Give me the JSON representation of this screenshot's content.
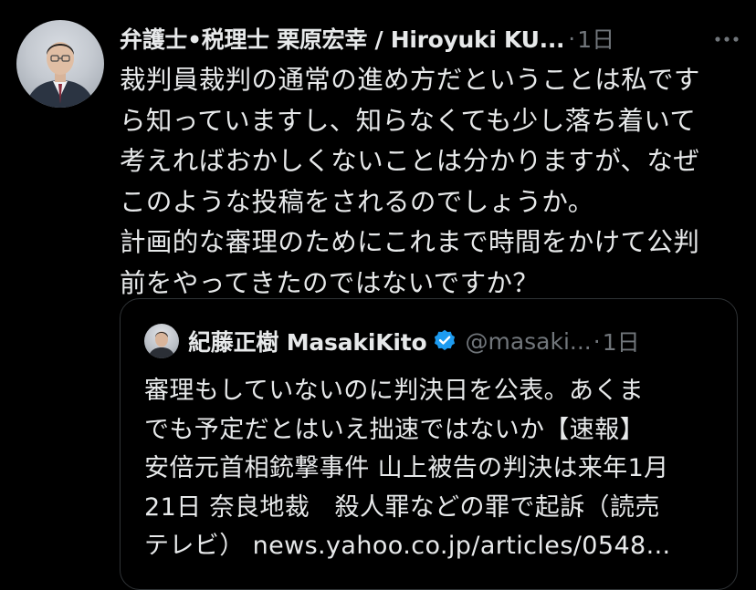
{
  "post": {
    "author_name": "弁護士•税理士 栗原宏幸 / Hiroyuki KU...",
    "dot": "·",
    "time": "1日",
    "more_icon": "more-horizontal-icon",
    "text_lines": [
      "裁判員裁判の通常の進め方だということは私です",
      "ら知っていますし、知らなくても少し落ち着いて",
      "考えればおかしくないことは分かりますが、なぜ",
      "このような投稿をされるのでしょうか。",
      "計画的な審理のためにこれまで時間をかけて公判",
      "前をやってきたのではないですか？"
    ]
  },
  "quoted_post": {
    "author_name": "紀藤正樹 MasakiKito",
    "verified_icon": "verified-badge-icon",
    "handle": "@masaki...",
    "dot": "·",
    "time": "1日",
    "text_lines": [
      "審理もしていないのに判決日を公表。あくま",
      "でも予定だとはいえ拙速ではないか【速報】",
      "安倍元首相銃撃事件 山上被告の判決は来年1月",
      "21日 奈良地裁　殺人罪などの罪で起訴（読売",
      "テレビ） news.yahoo.co.jp/articles/0548..."
    ]
  },
  "colors": {
    "background": "#000000",
    "text": "#e7e9ea",
    "secondary": "#71767b",
    "border": "#2f3336",
    "verified": "#1d9bf0"
  }
}
